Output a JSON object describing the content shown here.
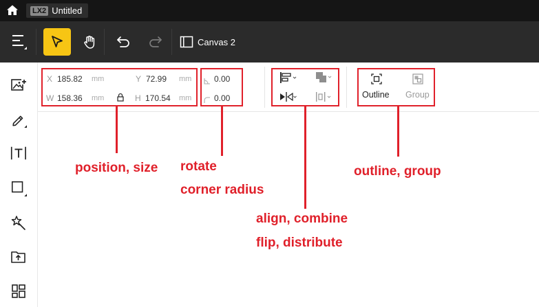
{
  "titlebar": {
    "badge": "LX2",
    "document_name": "Untitled"
  },
  "toolbar": {
    "canvas_label": "Canvas 2",
    "accent_color": "#f7c514"
  },
  "properties": {
    "x_label": "X",
    "x_value": "185.82",
    "x_unit": "mm",
    "y_label": "Y",
    "y_value": "72.99",
    "y_unit": "mm",
    "w_label": "W",
    "w_value": "158.36",
    "w_unit": "mm",
    "h_label": "H",
    "h_value": "170.54",
    "h_unit": "mm",
    "rotate_value": "0.00",
    "corner_radius_value": "0.00"
  },
  "buttons": {
    "outline_label": "Outline",
    "group_label": "Group"
  },
  "annotations": {
    "position_size": "position, size",
    "rotate": "rotate",
    "corner_radius": "corner radius",
    "align_combine": "align, combine",
    "flip_distribute": "flip, distribute",
    "outline_group": "outline, group",
    "color": "#e0202a"
  }
}
